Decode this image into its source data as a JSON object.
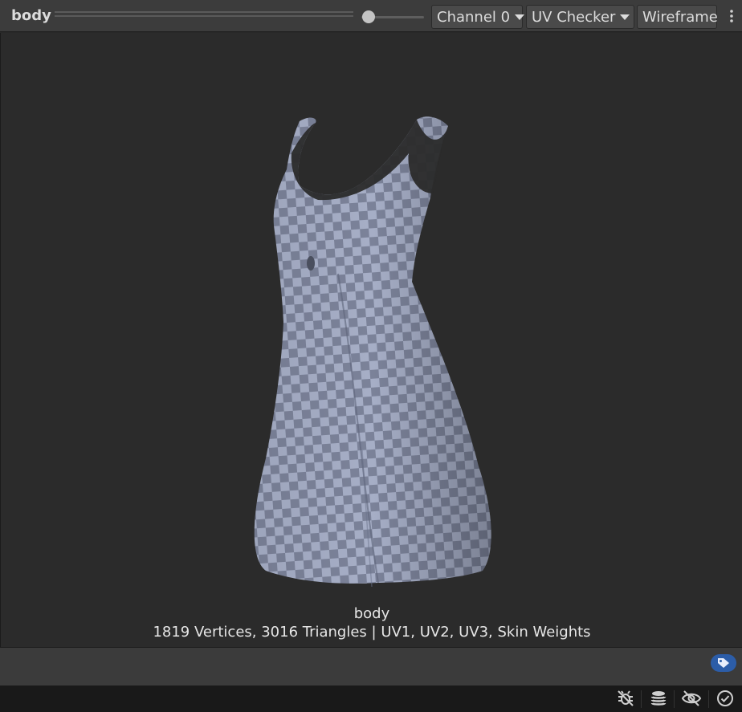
{
  "toolbar": {
    "title": "body",
    "channel_label": "Channel 0",
    "view_mode_label": "UV Checker",
    "wireframe_label": "Wireframe"
  },
  "viewport": {
    "mesh_name": "body",
    "mesh_stats": "1819 Vertices, 3016 Triangles | UV1, UV2, UV3, Skin Weights"
  },
  "icons": {
    "tag": "tag-icon",
    "status": [
      "debug-off-icon",
      "layers-icon",
      "visibility-off-icon",
      "checkmark-circle-icon"
    ]
  },
  "colors": {
    "background": "#282828",
    "toolbar": "#3c3c3c",
    "checker_light": "#a6aec6",
    "checker_dark": "#7b8299",
    "accent": "#2c5da8"
  }
}
